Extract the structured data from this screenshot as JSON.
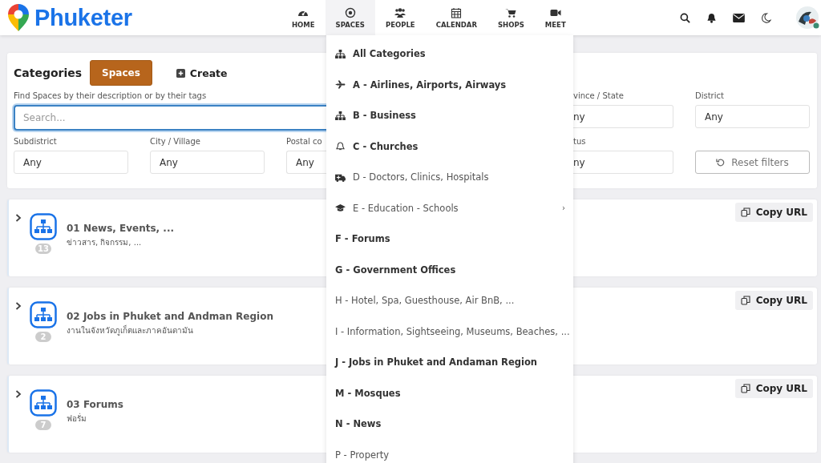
{
  "brand": "Phuketer",
  "nav": [
    {
      "label": "HOME",
      "kind": "gauge",
      "selected": false
    },
    {
      "label": "SPACES",
      "kind": "target",
      "selected": true
    },
    {
      "label": "PEOPLE",
      "kind": "people",
      "selected": false
    },
    {
      "label": "CALENDAR",
      "kind": "calendar",
      "selected": false
    },
    {
      "label": "SHOPS",
      "kind": "cart",
      "selected": false
    },
    {
      "label": "MEET",
      "kind": "video",
      "selected": false
    }
  ],
  "filters": {
    "title": "Categories",
    "tab": {
      "label": "Spaces",
      "selected": true
    },
    "create": "Create",
    "search_label": "Find Spaces by their description or by their tags",
    "search_placeholder": "Search...",
    "fields": [
      {
        "kind": "search"
      },
      {
        "kind": "select-cut-left",
        "label": "vince / State",
        "value": "ny"
      },
      {
        "kind": "select",
        "label": "District",
        "value": "Any"
      },
      {
        "kind": "select",
        "label": "Subdistrict",
        "value": "Any"
      },
      {
        "kind": "select",
        "label": "City / Village",
        "value": "Any"
      },
      {
        "kind": "select-cut-right",
        "label": "Postal co",
        "value": "Any"
      },
      {
        "kind": "select-cut-left",
        "label": "tus",
        "value": "ny"
      },
      {
        "kind": "reset",
        "label": "Reset filters"
      }
    ]
  },
  "categories": [
    {
      "title": "01 News, Events, ...",
      "subtitle": "ข่าวสาร, กิจกรรม, ...",
      "count": "13",
      "expanded": false,
      "copy": "Copy URL"
    },
    {
      "title": "02 Jobs in Phuket and Andman Region",
      "subtitle": "งานในจังหวัดภูเก็ตและภาคอันดามัน",
      "count": "2",
      "expanded": false,
      "copy": "Copy URL"
    },
    {
      "title": "03 Forums",
      "subtitle": "ฟอรั่ม",
      "count": "7",
      "expanded": false,
      "copy": "Copy URL"
    }
  ],
  "menu": [
    {
      "label": "All Categories",
      "kind": "sitemap",
      "bold": true
    },
    {
      "label": "A - Airlines, Airports, Airways",
      "kind": "plane",
      "bold": true
    },
    {
      "label": "B - Business",
      "kind": "sitemap",
      "bold": true
    },
    {
      "label": "C - Churches",
      "kind": "bell",
      "bold": true
    },
    {
      "label": "D - Doctors, Clinics, Hospitals",
      "kind": "ambulance",
      "bold": false
    },
    {
      "label": "E - Education - Schools",
      "kind": "cap",
      "bold": false,
      "arrow": "›"
    },
    {
      "label": "F - Forums",
      "kind": "plain",
      "bold": true
    },
    {
      "label": "G - Government Offices",
      "kind": "plain",
      "bold": true
    },
    {
      "label": "H - Hotel, Spa, Guesthouse, Air BnB, ...",
      "kind": "plain",
      "bold": false
    },
    {
      "label": "I - Information, Sightseeing, Museums, Beaches, ...",
      "kind": "plain",
      "bold": false
    },
    {
      "label": "J - Jobs in Phuket and Andaman Region",
      "kind": "plain",
      "bold": true
    },
    {
      "label": "M - Mosques",
      "kind": "plain",
      "bold": true
    },
    {
      "label": "N - News",
      "kind": "plain",
      "bold": true
    },
    {
      "label": "P - Property",
      "kind": "plain",
      "bold": false
    }
  ]
}
